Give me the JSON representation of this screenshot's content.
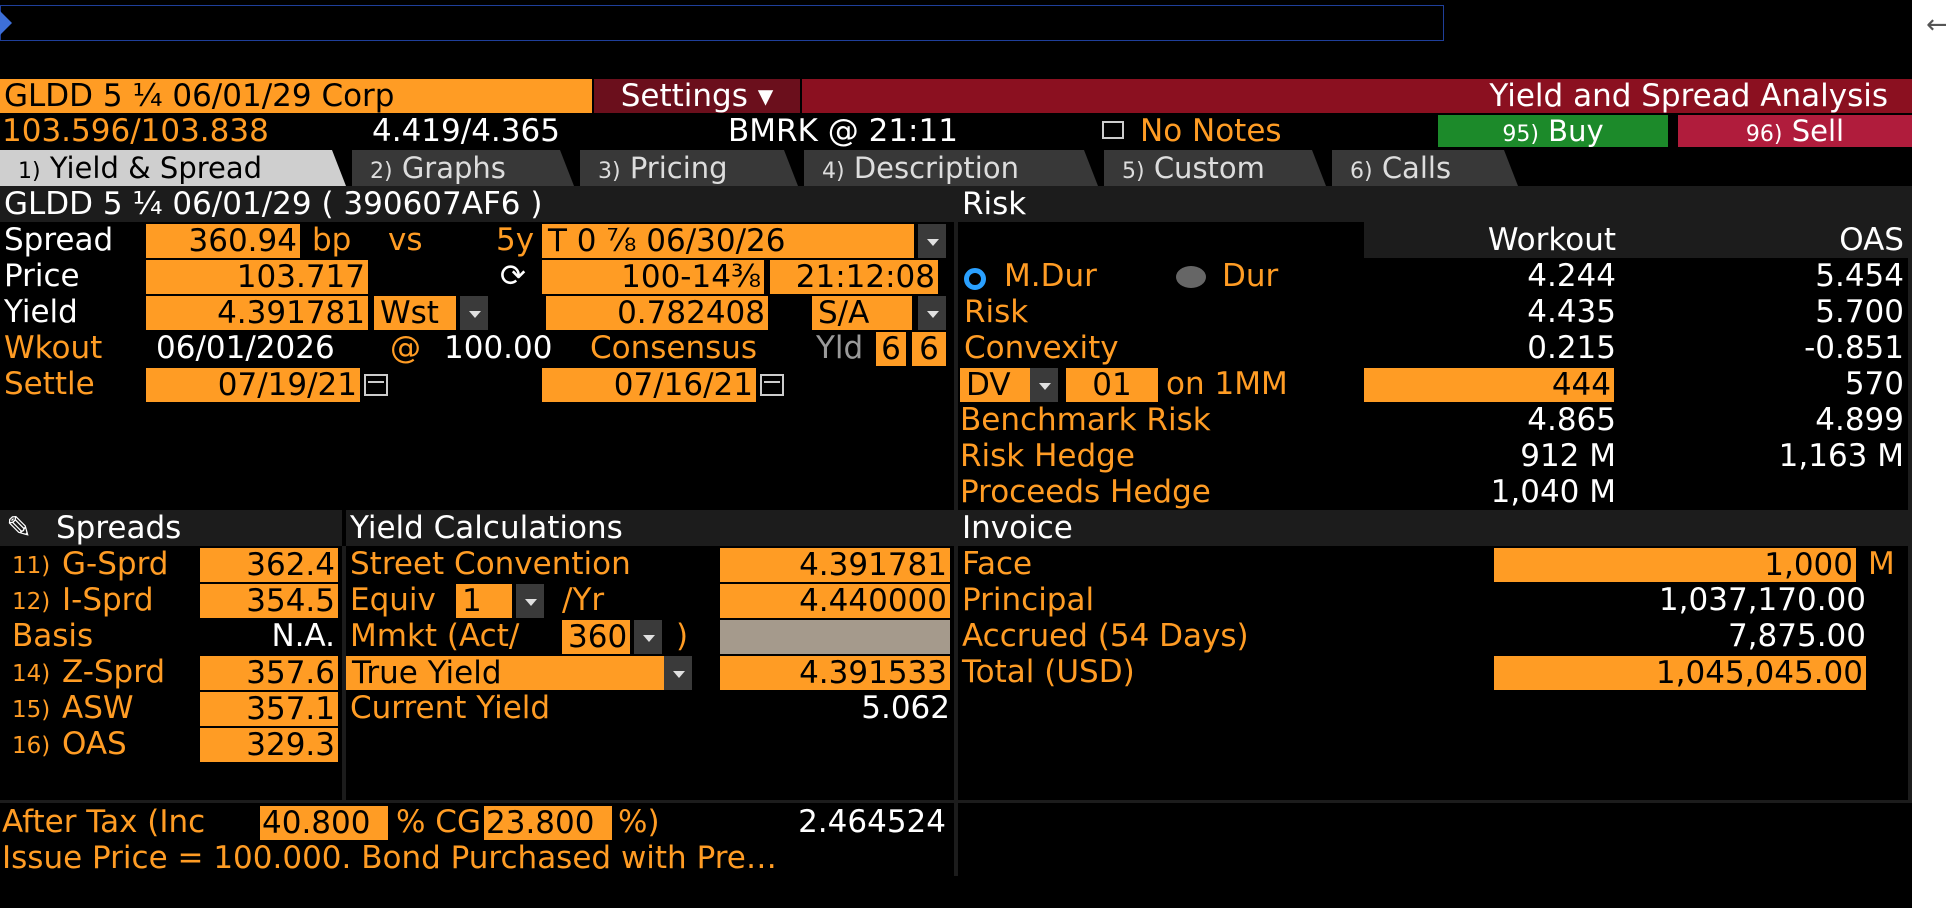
{
  "header": {
    "security": "GLDD 5 ¼ 06/01/29 Corp",
    "settings_label": "Settings ▾",
    "title": "Yield and Spread Analysis",
    "price_quote": "103.596/103.838",
    "yield_quote": "4.419/4.365",
    "source_time": "BMRK @ 21:11",
    "notes_label": "No Notes",
    "buy_num": "95)",
    "buy_label": "Buy",
    "sell_num": "96)",
    "sell_label": "Sell"
  },
  "tabs": [
    {
      "num": "1)",
      "label": "Yield & Spread"
    },
    {
      "num": "2)",
      "label": "Graphs"
    },
    {
      "num": "3)",
      "label": "Pricing"
    },
    {
      "num": "4)",
      "label": "Description"
    },
    {
      "num": "5)",
      "label": "Custom"
    },
    {
      "num": "6)",
      "label": "Calls"
    }
  ],
  "bond": {
    "heading": "GLDD 5 ¼ 06/01/29 ( 390607AF6 )",
    "spread_label": "Spread",
    "spread_value": "360.94",
    "spread_unit": "bp",
    "vs_label": "vs",
    "bench_tenor": "5y",
    "benchmark": "T 0 ⅞ 06/30/26",
    "price_label": "Price",
    "price_value": "103.717",
    "bench_price": "100-14⅜",
    "bench_time": "21:12:08",
    "yield_label": "Yield",
    "yield_value": "4.391781",
    "yield_type": "Wst",
    "bench_yield": "0.782408",
    "compounding": "S/A",
    "wkout_label": "Wkout",
    "wkout_date": "06/01/2026",
    "wkout_at": "@",
    "wkout_price": "100.00",
    "consensus_label": "Consensus",
    "yld_label": "Yld",
    "yld_a": "6",
    "yld_b": "6",
    "settle_label": "Settle",
    "settle_date": "07/19/21",
    "bench_settle": "07/16/21"
  },
  "risk": {
    "heading": "Risk",
    "col_workout": "Workout",
    "col_oas": "OAS",
    "rows": [
      {
        "label": "M.Dur",
        "workout": "4.244",
        "oas": "5.454"
      },
      {
        "label": "Risk",
        "workout": "4.435",
        "oas": "5.700"
      },
      {
        "label": "Convexity",
        "workout": "0.215",
        "oas": "-0.851"
      },
      {
        "label": "",
        "workout": "444",
        "oas": "570"
      },
      {
        "label": "Benchmark Risk",
        "workout": "4.865",
        "oas": "4.899"
      },
      {
        "label": "Risk Hedge",
        "workout": "912",
        "oas": "1,163"
      },
      {
        "label": "Proceeds Hedge",
        "workout": "1,040",
        "oas": ""
      }
    ],
    "dur_label": "Dur",
    "dv_label": "DV",
    "dv_value": "01",
    "dv_on": "on 1MM",
    "unit_m": "M"
  },
  "spreads": {
    "heading": "Spreads",
    "rows": [
      {
        "num": "11)",
        "label": "G-Sprd",
        "value": "362.4"
      },
      {
        "num": "12)",
        "label": "I-Sprd",
        "value": "354.5"
      },
      {
        "num": "",
        "label": "Basis",
        "value": "N.A."
      },
      {
        "num": "14)",
        "label": "Z-Sprd",
        "value": "357.6"
      },
      {
        "num": "15)",
        "label": "ASW",
        "value": "357.1"
      },
      {
        "num": "16)",
        "label": "OAS",
        "value": "329.3"
      }
    ]
  },
  "yieldcalc": {
    "heading": "Yield Calculations",
    "street_label": "Street Convention",
    "street_value": "4.391781",
    "equiv_label": "Equiv",
    "equiv_freq": "1",
    "equiv_per": "/Yr",
    "equiv_value": "4.440000",
    "mmkt_label": "Mmkt (Act/",
    "mmkt_basis": "360",
    "mmkt_close": ")",
    "true_label": "True Yield",
    "true_value": "4.391533",
    "current_label": "Current Yield",
    "current_value": "5.062"
  },
  "invoice": {
    "heading": "Invoice",
    "face_label": "Face",
    "face_value": "1,000",
    "face_unit": "M",
    "principal_label": "Principal",
    "principal_value": "1,037,170.00",
    "accrued_label": "Accrued (54 Days)",
    "accrued_value": "7,875.00",
    "total_label": "Total  (USD)",
    "total_value": "1,045,045.00"
  },
  "aftertax": {
    "label": "After Tax (Inc",
    "inc_value": "40.800",
    "cg_label": "% CG",
    "cg_value": "23.800",
    "close": "%)",
    "result": "2.464524"
  },
  "note": "Issue Price = 100.000. Bond Purchased with Pre…",
  "edge_glyph": "←",
  "colors": {
    "orange": "#ff9c24",
    "title_bar": "#8b1020",
    "buy": "#1c8a2a",
    "sell": "#b01c3c"
  }
}
